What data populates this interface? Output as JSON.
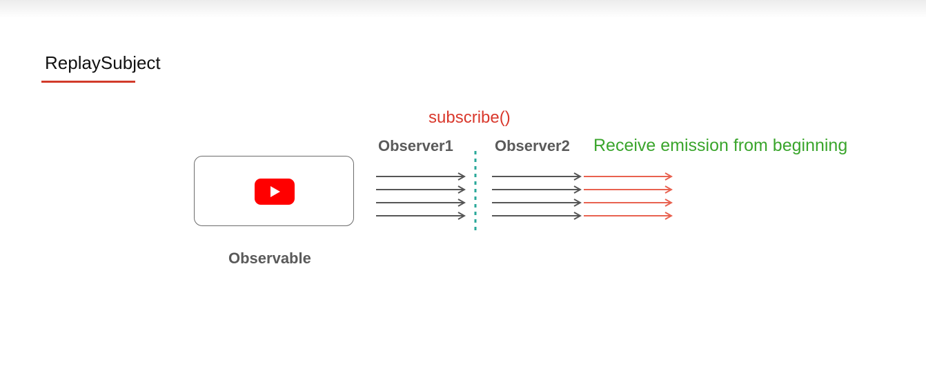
{
  "title": "ReplaySubject",
  "observable": {
    "label": "Observable",
    "icon": "youtube-play-icon"
  },
  "subscribe_label": "subscribe()",
  "observers": [
    {
      "label": "Observer1"
    },
    {
      "label": "Observer2"
    }
  ],
  "replay_label": "Receive emission from beginning",
  "colors": {
    "accent_red": "#d23a2a",
    "replay_green": "#3aa52c",
    "arrow_dark": "#555555",
    "arrow_red": "#e8614f",
    "divider_teal": "#2aa89a",
    "youtube_red": "#ff0000"
  }
}
